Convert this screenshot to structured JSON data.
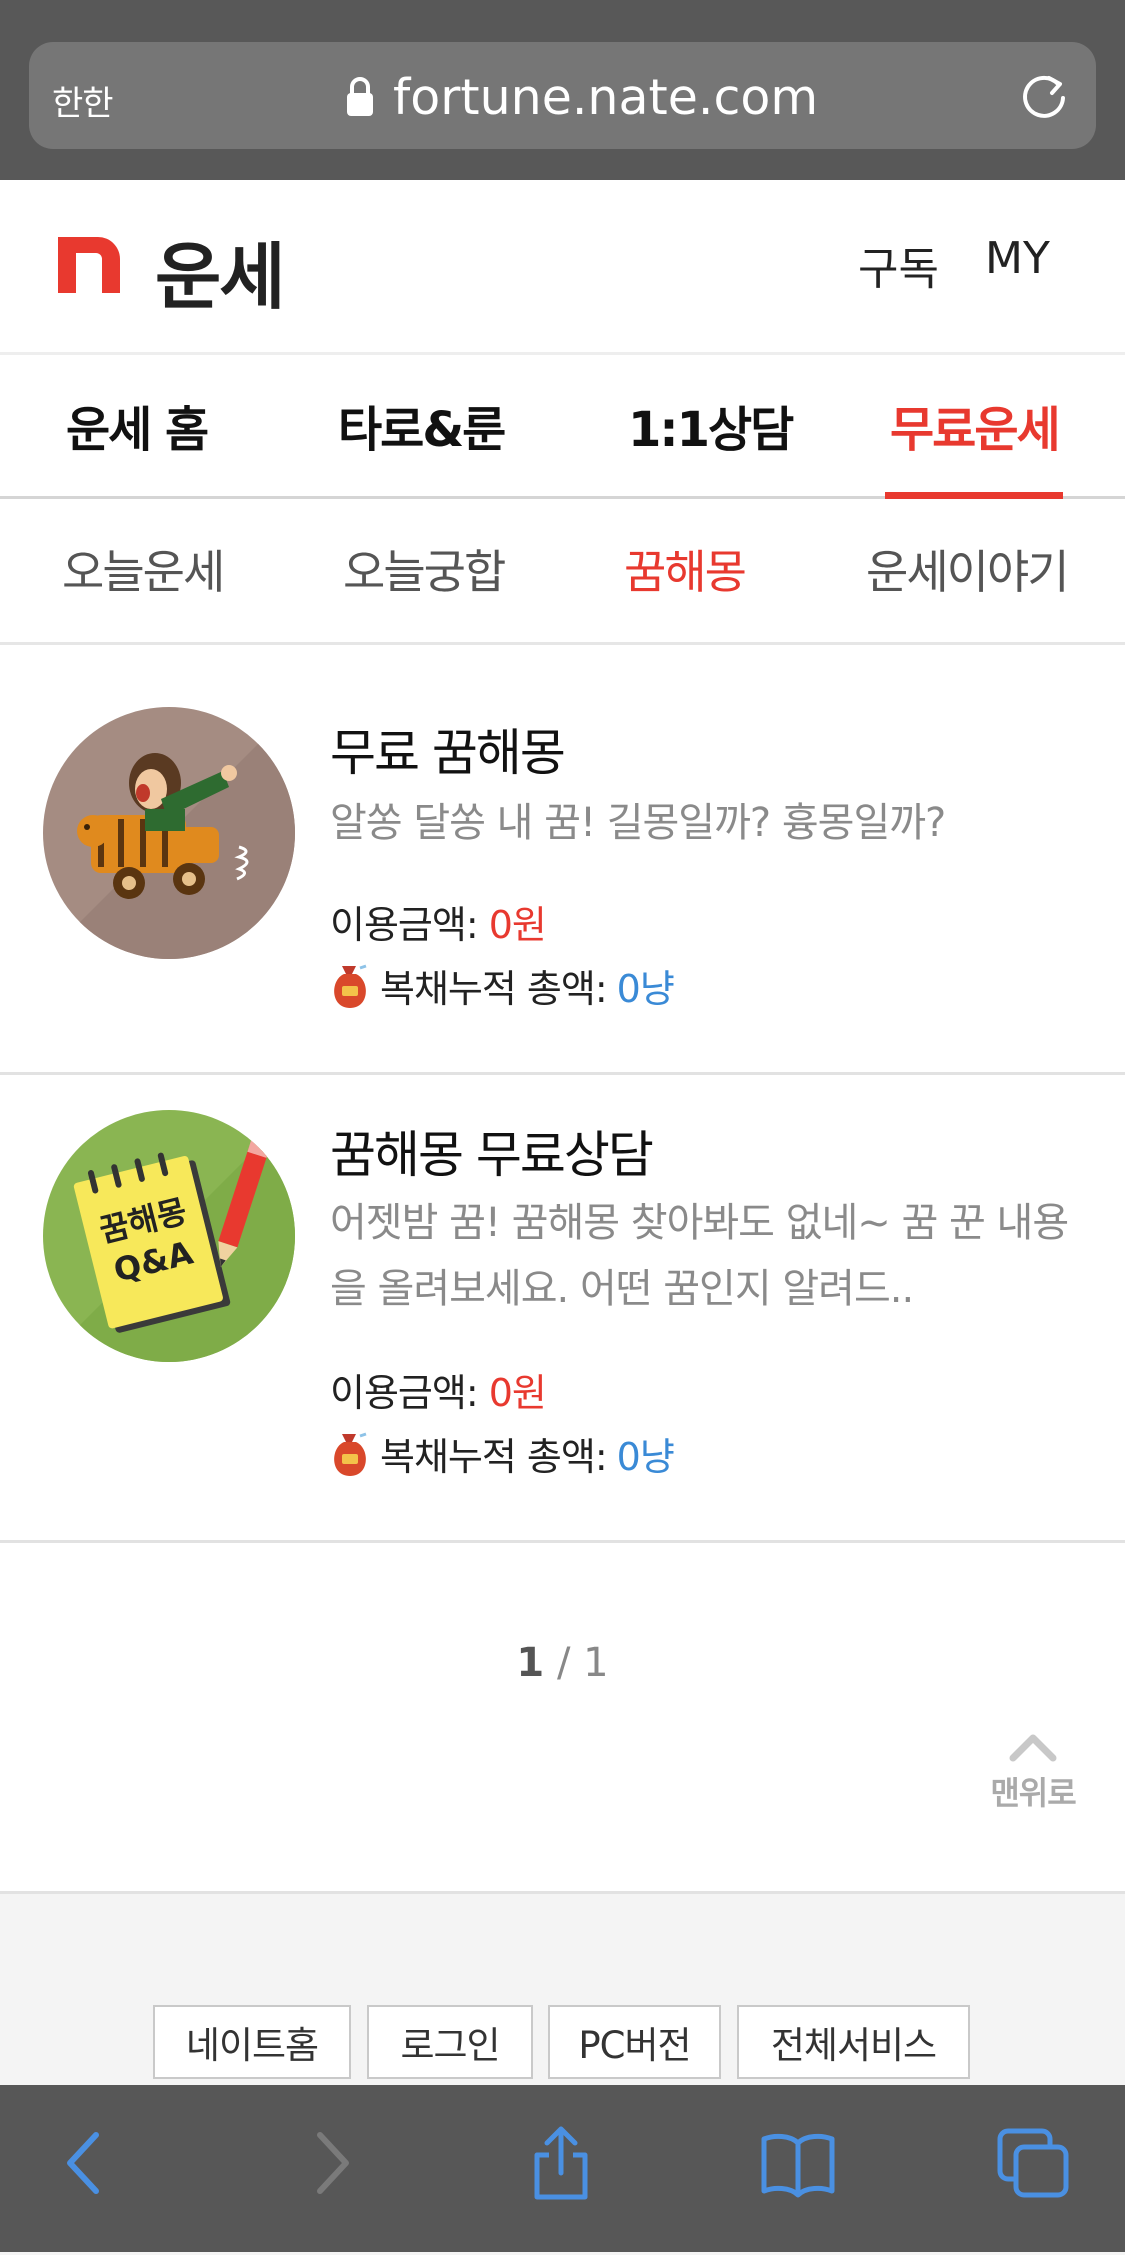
{
  "browser": {
    "aa_label": "한한",
    "url": "fortune.nate.com"
  },
  "header": {
    "brand_title": "운세",
    "subscribe_label": "구독",
    "my_label": "MY"
  },
  "main_nav": {
    "tabs": [
      {
        "label": "운세 홈"
      },
      {
        "label": "타로&룬"
      },
      {
        "label": "1:1상담"
      },
      {
        "label": "무료운세",
        "active": true
      }
    ]
  },
  "sub_nav": {
    "tabs": [
      {
        "label": "오늘운세"
      },
      {
        "label": "오늘궁합"
      },
      {
        "label": "꿈해몽",
        "active": true
      },
      {
        "label": "운세이야기"
      }
    ]
  },
  "items": [
    {
      "title": "무료 꿈해몽",
      "desc": "알쏭 달쏭 내 꿈! 길몽일까? 흉몽일까?",
      "price_label": "이용금액:",
      "price_value": "0원",
      "acc_label": "복채누적 총액:",
      "acc_value": "0냥"
    },
    {
      "title": "꿈해몽 무료상담",
      "desc": "어젯밤 꿈! 꿈해몽 찾아봐도 없네~ 꿈 꾼 내용을 올려보세요. 어떤 꿈인지 알려드..",
      "thumb_text_1": "꿈해몽",
      "thumb_text_2": "Q&A",
      "price_label": "이용금액:",
      "price_value": "0원",
      "acc_label": "복채누적 총액:",
      "acc_value": "0냥"
    }
  ],
  "pager": {
    "current": "1",
    "separator": "/",
    "total": "1"
  },
  "totop_label": "맨위로",
  "footer": {
    "buttons": [
      "네이트홈",
      "로그인",
      "PC버전",
      "전체서비스"
    ]
  },
  "colors": {
    "accent": "#e8392f",
    "link_blue": "#3a8ad6",
    "safari_bar": "#585858",
    "safari_icon": "#4a90e2"
  },
  "icons": {
    "lock": "lock-icon",
    "reload": "reload-icon",
    "back": "back-arrow-icon",
    "forward": "forward-arrow-icon",
    "share": "share-icon",
    "bookmarks": "bookmarks-icon",
    "tabs": "tabs-icon",
    "pouch": "money-pouch-icon",
    "top": "chevron-up-icon"
  }
}
